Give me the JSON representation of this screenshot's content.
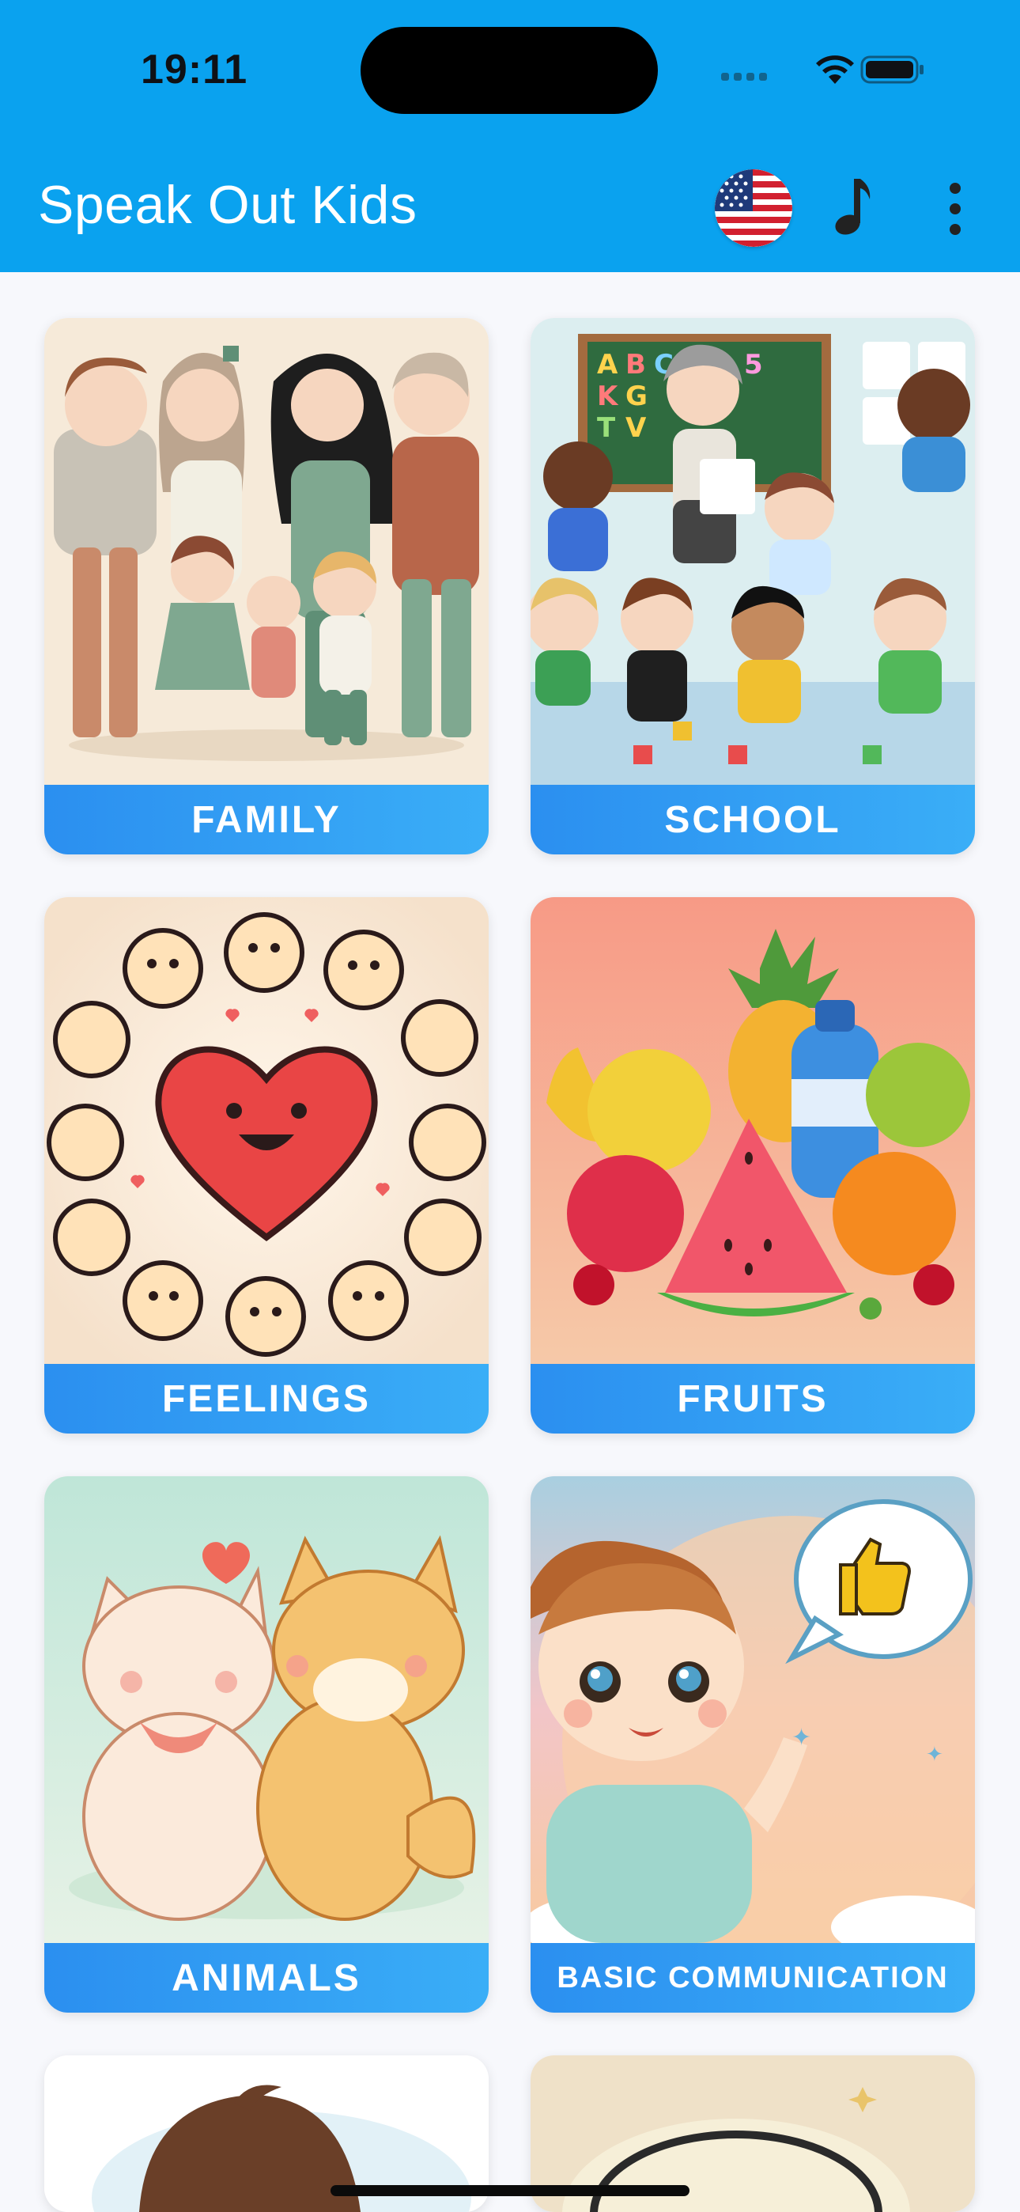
{
  "status_bar": {
    "time": "19:11",
    "icons": [
      "cellular-signal-icon",
      "wifi-icon",
      "battery-icon"
    ]
  },
  "header": {
    "title": "Speak Out Kids",
    "language_icon": "us-flag-icon",
    "music_icon": "music-note-icon",
    "menu_icon": "more-vertical-icon",
    "background_color": "#0aa2ef"
  },
  "categories": [
    {
      "label": "FAMILY"
    },
    {
      "label": "SCHOOL"
    },
    {
      "label": "FEELINGS"
    },
    {
      "label": "FRUITS"
    },
    {
      "label": "ANIMALS"
    },
    {
      "label": "BASIC COMMUNICATION"
    }
  ],
  "colors": {
    "label_bar_start": "#2b8ff0",
    "label_bar_end": "#3aaef7",
    "page_background": "#f7f8fc"
  }
}
